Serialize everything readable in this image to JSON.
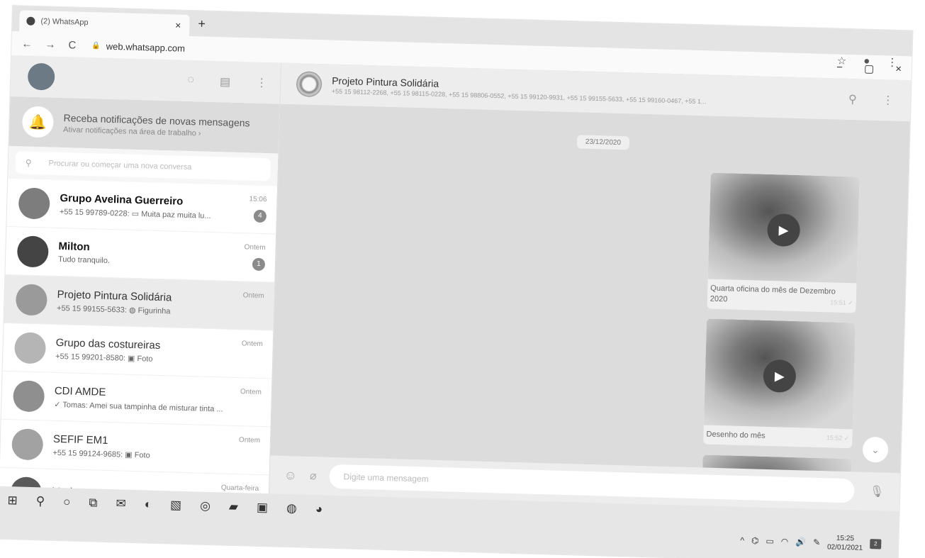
{
  "browser": {
    "tab_title": "(2) WhatsApp",
    "tab_close": "×",
    "new_tab": "+",
    "back": "←",
    "forward": "→",
    "reload": "C",
    "url": "web.whatsapp.com",
    "minimize": "−",
    "restore": "▢",
    "close": "×",
    "star": "☆",
    "menu": "⋮"
  },
  "sidebar": {
    "notification": {
      "title": "Receba notificações de novas mensagens",
      "subtitle": "Ativar notificações na área de trabalho ›"
    },
    "search_placeholder": "Procurar ou começar uma nova conversa",
    "chats": [
      {
        "name": "Grupo Avelina Guerreiro",
        "preview": "+55 15 99789-0228: ▭ Muita paz muita lu...",
        "time": "15:06",
        "unread": "4",
        "avatar_color": "#7d7d7d"
      },
      {
        "name": "Milton",
        "preview": "Tudo tranquilo.",
        "time": "Ontem",
        "unread": "1",
        "avatar_color": "#444444"
      },
      {
        "name": "Projeto Pintura Solidária",
        "preview": "+55 15 99155-5633: ◍ Figurinha",
        "time": "Ontem",
        "unread": "",
        "avatar_color": "#9a9a9a"
      },
      {
        "name": "Grupo das costureiras",
        "preview": "+55 15 99201-8580: ▣ Foto",
        "time": "Ontem",
        "unread": "",
        "avatar_color": "#b5b5b5"
      },
      {
        "name": "CDI AMDE",
        "preview": "✓ Tomas: Amei sua tampinha de misturar tinta ...",
        "time": "Ontem",
        "unread": "",
        "avatar_color": "#8f8f8f"
      },
      {
        "name": "SEFIF EM1",
        "preview": "+55 15 99124-9685: ▣ Foto",
        "time": "Ontem",
        "unread": "",
        "avatar_color": "#a2a2a2"
      },
      {
        "name": "Maria",
        "preview": "",
        "time": "Quarta-feira",
        "unread": "",
        "avatar_color": "#5a5a5a"
      }
    ]
  },
  "conversation": {
    "title": "Projeto Pintura Solidária",
    "members": "+55 15 98112-2268, +55 15 98115-0228, +55 15 98806-0552, +55 15 99120-9931, +55 15 99155-5633, +55 15 99160-0467, +55 1...",
    "date_chip": "23/12/2020",
    "messages": [
      {
        "caption": "Quarta oficina do mês de Dezembro 2020",
        "time": "15:51 ✓"
      },
      {
        "caption": "Desenho do mês",
        "time": "15:52 ✓"
      }
    ],
    "composer_placeholder": "Digite uma mensagem"
  },
  "taskbar": {
    "time": "15:25",
    "date": "02/01/2021",
    "notifications": "2"
  }
}
